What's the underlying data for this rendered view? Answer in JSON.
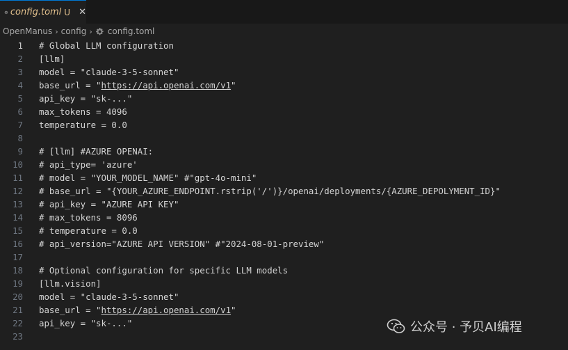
{
  "tab": {
    "filename": "config.toml",
    "modified": "U",
    "close": "✕"
  },
  "breadcrumb": {
    "items": [
      "OpenManus",
      "config",
      "config.toml"
    ],
    "separator": "›"
  },
  "editor": {
    "active_line": 1,
    "lines": [
      {
        "n": "1",
        "text": "# Global LLM configuration"
      },
      {
        "n": "2",
        "text": "[llm]"
      },
      {
        "n": "3",
        "text": "model = \"claude-3-5-sonnet\""
      },
      {
        "n": "4",
        "pre": "base_url = \"",
        "link": "https://api.openai.com/v1",
        "post": "\""
      },
      {
        "n": "5",
        "text": "api_key = \"sk-...\""
      },
      {
        "n": "6",
        "text": "max_tokens = 4096"
      },
      {
        "n": "7",
        "text": "temperature = 0.0"
      },
      {
        "n": "8",
        "text": ""
      },
      {
        "n": "9",
        "text": "# [llm] #AZURE OPENAI:"
      },
      {
        "n": "10",
        "text": "# api_type= 'azure'"
      },
      {
        "n": "11",
        "text": "# model = \"YOUR_MODEL_NAME\" #\"gpt-4o-mini\""
      },
      {
        "n": "12",
        "text": "# base_url = \"{YOUR_AZURE_ENDPOINT.rstrip('/')}/openai/deployments/{AZURE_DEPOLYMENT_ID}\""
      },
      {
        "n": "13",
        "text": "# api_key = \"AZURE API KEY\""
      },
      {
        "n": "14",
        "text": "# max_tokens = 8096"
      },
      {
        "n": "15",
        "text": "# temperature = 0.0"
      },
      {
        "n": "16",
        "text": "# api_version=\"AZURE API VERSION\" #\"2024-08-01-preview\""
      },
      {
        "n": "17",
        "text": ""
      },
      {
        "n": "18",
        "text": "# Optional configuration for specific LLM models"
      },
      {
        "n": "19",
        "text": "[llm.vision]"
      },
      {
        "n": "20",
        "text": "model = \"claude-3-5-sonnet\""
      },
      {
        "n": "21",
        "pre": "base_url = \"",
        "link": "https://api.openai.com/v1",
        "post": "\""
      },
      {
        "n": "22",
        "text": "api_key = \"sk-...\""
      },
      {
        "n": "23",
        "text": ""
      }
    ]
  },
  "watermark": {
    "text": "公众号 · 予贝AI编程",
    "icon": "wechat-icon"
  },
  "colors": {
    "background": "#1f1f1f",
    "tab_modified": "#e2c08d",
    "line_number": "#6e7681",
    "code_text": "#d4d4d4"
  }
}
